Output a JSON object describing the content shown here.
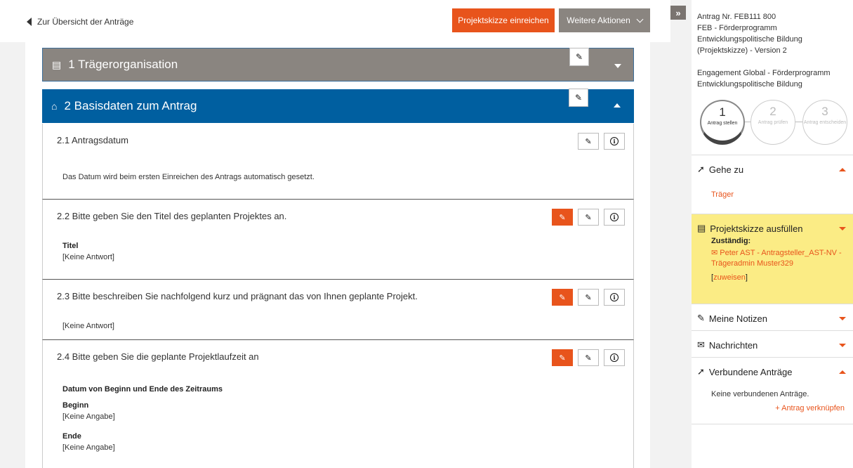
{
  "header": {
    "back_label": "Zur Übersicht der Anträge",
    "submit_label": "Projektskizze einreichen",
    "more_actions_label": "Weitere Aktionen"
  },
  "sections": [
    {
      "number_title": "1 Trägerorganisation",
      "state": "collapsed"
    },
    {
      "number_title": "2 Basisdaten zum Antrag",
      "state": "expanded"
    }
  ],
  "questions": {
    "q1": {
      "title": "2.1 Antragsdatum",
      "note": "Das Datum wird beim ersten Einreichen des Antrags automatisch gesetzt."
    },
    "q2": {
      "title": "2.2 Bitte geben Sie den Titel des geplanten Projektes an.",
      "field_label": "Titel",
      "answer": "[Keine Antwort]"
    },
    "q3": {
      "title": "2.3 Bitte beschreiben Sie nachfolgend kurz und prägnant das von Ihnen geplante Projekt.",
      "answer": "[Keine Antwort]"
    },
    "q4": {
      "title": "2.4 Bitte geben Sie die geplante Projektlaufzeit an",
      "subheading": "Datum von Beginn und Ende des Zeitraums",
      "begin_label": "Beginn",
      "begin_value": "[Keine Angabe]",
      "end_label": "Ende",
      "end_value": "[Keine Angabe]"
    }
  },
  "sidebar": {
    "collapse_glyph": "»",
    "antrag_lines": [
      "Antrag Nr. FEB111 800",
      "FEB - Förderprogramm",
      "Entwicklungspolitische Bildung",
      "(Projektskizze) - Version 2"
    ],
    "program_lines": [
      "Engagement Global - Förderprogramm",
      "Entwicklungspolitische Bildung"
    ],
    "steps": [
      {
        "num": "1",
        "label": "Antrag stellen",
        "active": true
      },
      {
        "num": "2",
        "label": "Antrag prüfen",
        "active": false
      },
      {
        "num": "3",
        "label": "Antrag entscheiden",
        "active": false
      }
    ],
    "goto": {
      "title": "Gehe zu",
      "link": "Träger"
    },
    "task": {
      "title": "Projektskizze ausfüllen",
      "responsible_label": "Zuständig:",
      "responsible_line1": "Peter AST - Antragsteller_AST-NV -",
      "responsible_line2": "Trägeradmin Muster329",
      "assign_open": "[",
      "assign_link": "zuweisen",
      "assign_close": "]"
    },
    "notes": {
      "title": "Meine Notizen"
    },
    "messages": {
      "title": "Nachrichten"
    },
    "linked": {
      "title": "Verbundene Anträge",
      "empty_text": "Keine verbundenen Anträge.",
      "link_label": "+ Antrag verknüpfen"
    }
  },
  "colors": {
    "accent": "#e8541c",
    "section_blue": "#005fa0",
    "section_grey": "#8a8580",
    "task_yellow": "#fbec85"
  }
}
